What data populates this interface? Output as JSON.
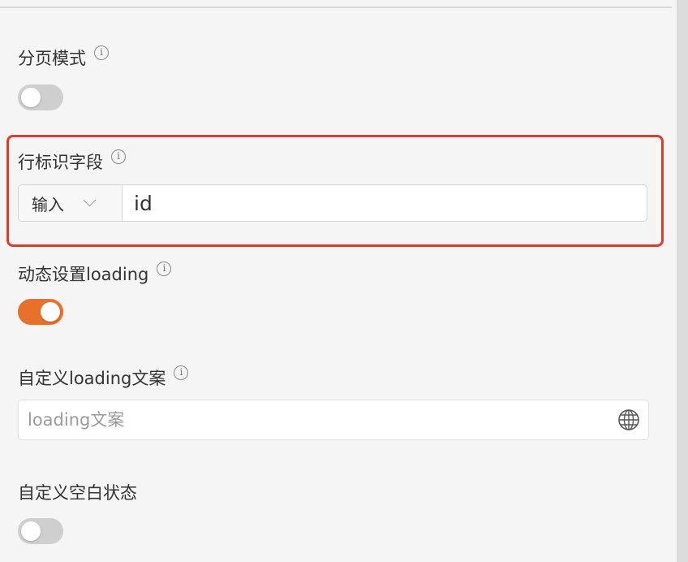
{
  "settings": {
    "paging_mode": {
      "label": "分页模式",
      "enabled": false
    },
    "row_key": {
      "label": "行标识字段",
      "mode_selected": "输入",
      "value": "id"
    },
    "dynamic_loading": {
      "label": "动态设置loading",
      "enabled": true
    },
    "custom_loading_text": {
      "label": "自定义loading文案",
      "placeholder": "loading文案",
      "value": ""
    },
    "custom_empty_state": {
      "label": "自定义空白状态",
      "enabled": false
    }
  },
  "icons": {
    "info": "info-icon",
    "dropdown": "chevron-down-icon",
    "language": "globe-icon"
  },
  "colors": {
    "accent": "#e8702a",
    "highlight_border": "#e03c2c",
    "toggle_off": "#cfcfcf"
  }
}
